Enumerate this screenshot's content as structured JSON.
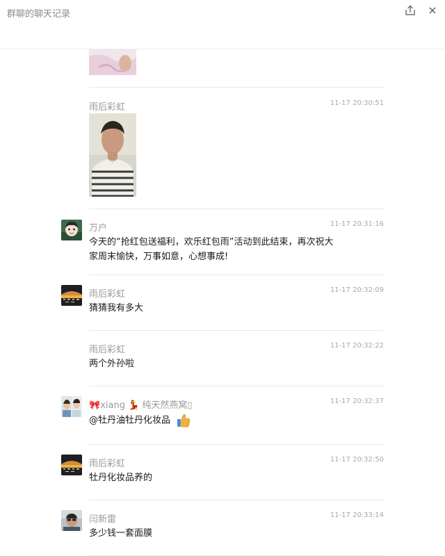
{
  "window": {
    "title": "群聊的聊天记录",
    "share_icon": "share-icon",
    "close_icon": "close-icon"
  },
  "messages": [
    {
      "sender": "",
      "time": "",
      "type": "image",
      "image_desc": "partial-photo-top"
    },
    {
      "sender": "雨后彩虹",
      "time": "11-17 20:30:51",
      "type": "image"
    },
    {
      "sender": "万户",
      "time": "11-17 20:31:16",
      "type": "text",
      "text_line1": "今天的“抢红包送福利，欢乐红包雨”活动到此结束，再次祝大",
      "text_line2": "家周末愉快，万事如意，心想事成!"
    },
    {
      "sender": "雨后彩虹",
      "time": "11-17 20:32:09",
      "type": "text",
      "text": "猜猜我有多大"
    },
    {
      "sender": "雨后彩虹",
      "time": "11-17 20:32:22",
      "type": "text",
      "text": "两个外孙啦"
    },
    {
      "sender_prefix": "🎀",
      "sender_name": "xiang",
      "sender_mid": "💃",
      "sender_suffix": "纯天然燕窝▯",
      "time": "11-17 20:32:37",
      "type": "text",
      "text": "@牡丹油牡丹化妆品",
      "emoji": "👍"
    },
    {
      "sender": "雨后彩虹",
      "time": "11-17 20:32:50",
      "type": "text",
      "text": "牡丹化妆品养的"
    },
    {
      "sender": "闫新雷",
      "time": "11-17 20:33:14",
      "type": "text",
      "text": "多少钱一套面膜"
    }
  ]
}
